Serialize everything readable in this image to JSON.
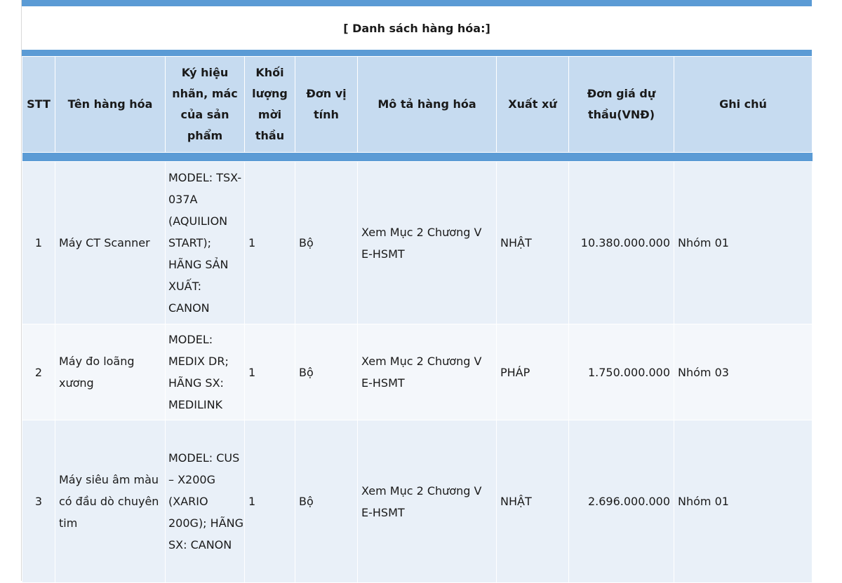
{
  "list_title": "[ Danh sách hàng hóa:]",
  "columns": [
    "STT",
    "Tên hàng hóa",
    "Ký hiệu nhãn, mác của sản phẩm",
    "Khối lượng mời thầu",
    "Đơn vị tính",
    "Mô tả hàng hóa",
    "Xuất xứ",
    "Đơn giá dự thầu(VNĐ)",
    "Ghi chú"
  ],
  "rows": [
    {
      "stt": "1",
      "name": "Máy CT Scanner",
      "symbol": "MODEL: TSX-037A (AQUILION START); HÃNG SẢN XUẤT: CANON",
      "quantity": "1",
      "unit": "Bộ",
      "description": "Xem Mục 2 Chương V E-HSMT",
      "origin": "NHẬT",
      "price": "10.380.000.000",
      "note": "Nhóm 01"
    },
    {
      "stt": "2",
      "name": "Máy đo loãng xương",
      "symbol": "MODEL: MEDIX DR; HÃNG SX: MEDILINK",
      "quantity": "1",
      "unit": "Bộ",
      "description": "Xem Mục 2 Chương V E-HSMT",
      "origin": "PHÁP",
      "price": "1.750.000.000",
      "note": "Nhóm 03"
    },
    {
      "stt": "3",
      "name": "Máy siêu âm màu có đầu dò chuyên tim",
      "symbol": "MODEL: CUS – X200G (XARIO 200G); HÃNG SX: CANON",
      "quantity": "1",
      "unit": "Bộ",
      "description": "Xem Mục 2 Chương V E-HSMT",
      "origin": "NHẬT",
      "price": "2.696.000.000",
      "note": "Nhóm 01"
    }
  ]
}
